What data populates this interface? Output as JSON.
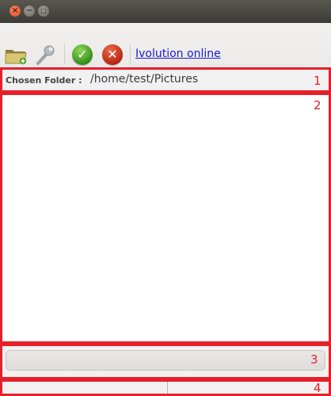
{
  "window": {
    "buttons": {
      "close_glyph": "×",
      "minimize_glyph": "−",
      "maximize_glyph": "□"
    }
  },
  "toolbar": {
    "link_text": "Ivolution online",
    "ok_glyph": "✓",
    "cancel_glyph": "✕"
  },
  "folder": {
    "label": "Chosen Folder :",
    "value": "/home/test/Pictures"
  },
  "annotations": {
    "n1": "1",
    "n2": "2",
    "n3": "3",
    "n4": "4"
  },
  "colors": {
    "annotation": "#e6202a",
    "link": "#1a1ad6"
  }
}
